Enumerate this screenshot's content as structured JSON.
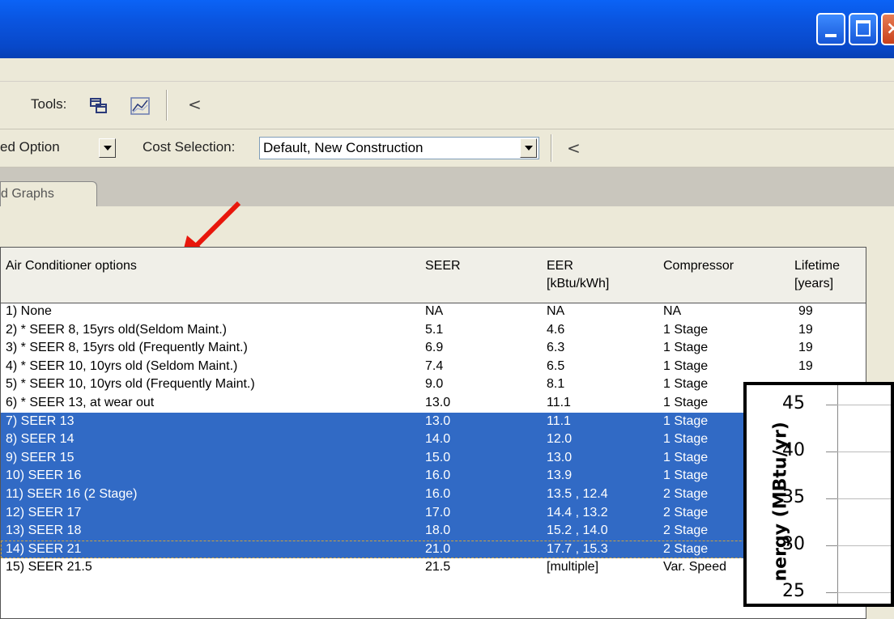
{
  "toolbar": {
    "tools_label": "Tools:",
    "selected_option_fragment": "ed Option",
    "cost_label": "Cost Selection:",
    "cost_value": "Default, New Construction",
    "collapse_glyph": "<"
  },
  "tabs": [
    {
      "label": "d Graphs"
    }
  ],
  "table": {
    "headers": {
      "name": "Air Conditioner options",
      "seer": "SEER",
      "eer_line1": "EER",
      "eer_line2": "[kBtu/kWh]",
      "compressor": "Compressor",
      "lifetime_line1": "Lifetime",
      "lifetime_line2": "[years]"
    },
    "rows": [
      {
        "name": "1) None",
        "seer": "NA",
        "eer": "NA",
        "compressor": "NA",
        "lifetime": "99",
        "selected": false
      },
      {
        "name": "2)  * SEER 8, 15yrs old(Seldom Maint.)",
        "seer": "5.1",
        "eer": "4.6",
        "compressor": "1 Stage",
        "lifetime": "19",
        "selected": false
      },
      {
        "name": "3)  * SEER 8, 15yrs old (Frequently Maint.)",
        "seer": "6.9",
        "eer": "6.3",
        "compressor": "1 Stage",
        "lifetime": "19",
        "selected": false
      },
      {
        "name": "4)  * SEER 10, 10yrs old (Seldom Maint.)",
        "seer": "7.4",
        "eer": "6.5",
        "compressor": "1 Stage",
        "lifetime": "19",
        "selected": false
      },
      {
        "name": "5)  * SEER 10, 10yrs old (Frequently Maint.)",
        "seer": "9.0",
        "eer": "8.1",
        "compressor": "1 Stage",
        "lifetime": "",
        "selected": false
      },
      {
        "name": "6)  * SEER 13, at wear out",
        "seer": "13.0",
        "eer": "11.1",
        "compressor": "1 Stage",
        "lifetime": "",
        "selected": false
      },
      {
        "name": "7)  SEER 13",
        "seer": "13.0",
        "eer": "11.1",
        "compressor": "1 Stage",
        "lifetime": "",
        "selected": true
      },
      {
        "name": "8)  SEER 14",
        "seer": "14.0",
        "eer": "12.0",
        "compressor": "1 Stage",
        "lifetime": "",
        "selected": true
      },
      {
        "name": "9)  SEER 15",
        "seer": "15.0",
        "eer": "13.0",
        "compressor": "1 Stage",
        "lifetime": "",
        "selected": true
      },
      {
        "name": "10)  SEER 16",
        "seer": "16.0",
        "eer": "13.9",
        "compressor": "1 Stage",
        "lifetime": "",
        "selected": true
      },
      {
        "name": "11)  SEER 16 (2 Stage)",
        "seer": "16.0",
        "eer": "13.5 , 12.4",
        "compressor": "2 Stage",
        "lifetime": "",
        "selected": true
      },
      {
        "name": "12)  SEER 17",
        "seer": "17.0",
        "eer": "14.4 , 13.2",
        "compressor": "2 Stage",
        "lifetime": "",
        "selected": true
      },
      {
        "name": "13)  SEER 18",
        "seer": "18.0",
        "eer": "15.2 , 14.0",
        "compressor": "2 Stage",
        "lifetime": "",
        "selected": true
      },
      {
        "name": "14)  SEER 21",
        "seer": "21.0",
        "eer": "17.7 , 15.3",
        "compressor": "2 Stage",
        "lifetime": "",
        "selected": true
      },
      {
        "name": "15)  SEER 21.5",
        "seer": "21.5",
        "eer": "[multiple]",
        "compressor": "Var. Speed",
        "lifetime": "",
        "selected": false
      }
    ]
  },
  "overlay_chart": {
    "ylabel": "nergy (MBtu/yr)",
    "ticks": [
      "45",
      "40",
      "35",
      "30",
      "25"
    ]
  },
  "colors": {
    "selection": "#316ac5",
    "annotation_arrow": "#e8170c",
    "titlebar": "#0a55e0"
  }
}
